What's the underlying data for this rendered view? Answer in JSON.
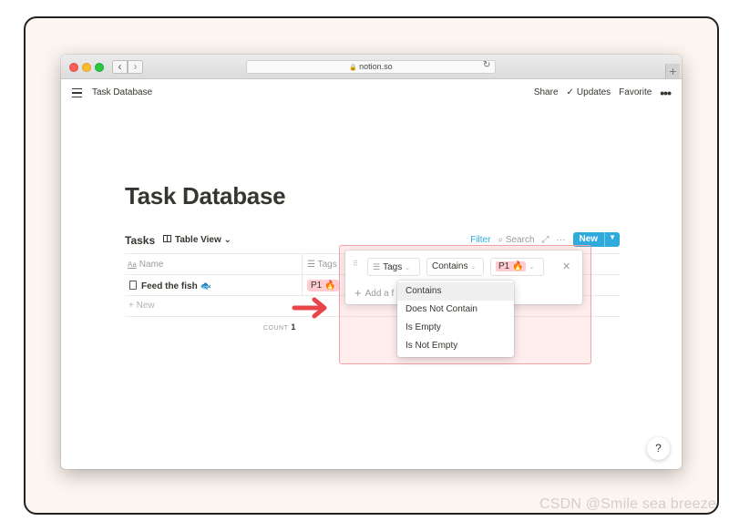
{
  "browser": {
    "url": "notion.so",
    "new_tab_symbol": "+"
  },
  "topbar": {
    "crumb": "Task Database",
    "share": "Share",
    "updates": "Updates",
    "favorite": "Favorite",
    "more": "•••"
  },
  "page": {
    "title": "Task Database"
  },
  "database": {
    "name": "Tasks",
    "view": "Table View",
    "filter": "Filter",
    "search": "Search",
    "new_button": "New",
    "columns": {
      "name": "Name",
      "tags": "Tags"
    },
    "rows": [
      {
        "name": "Feed the fish",
        "tag": "P1 🔥"
      }
    ],
    "new_row": "New",
    "count_label": "COUNT",
    "count_value": "1"
  },
  "filter_panel": {
    "property": "Tags",
    "operator": "Contains",
    "value": "P1 🔥",
    "add_filter": "Add a f"
  },
  "operator_dropdown": {
    "options": [
      "Contains",
      "Does Not Contain",
      "Is Empty",
      "Is Not Empty"
    ],
    "selected": "Contains"
  },
  "help": "?",
  "watermark": "CSDN @Smile sea breeze",
  "colors": {
    "accent": "#2eaadc",
    "tag_p1": "#ffccd1",
    "highlight_border": "#f2a3a6",
    "arrow": "#e8454b"
  }
}
